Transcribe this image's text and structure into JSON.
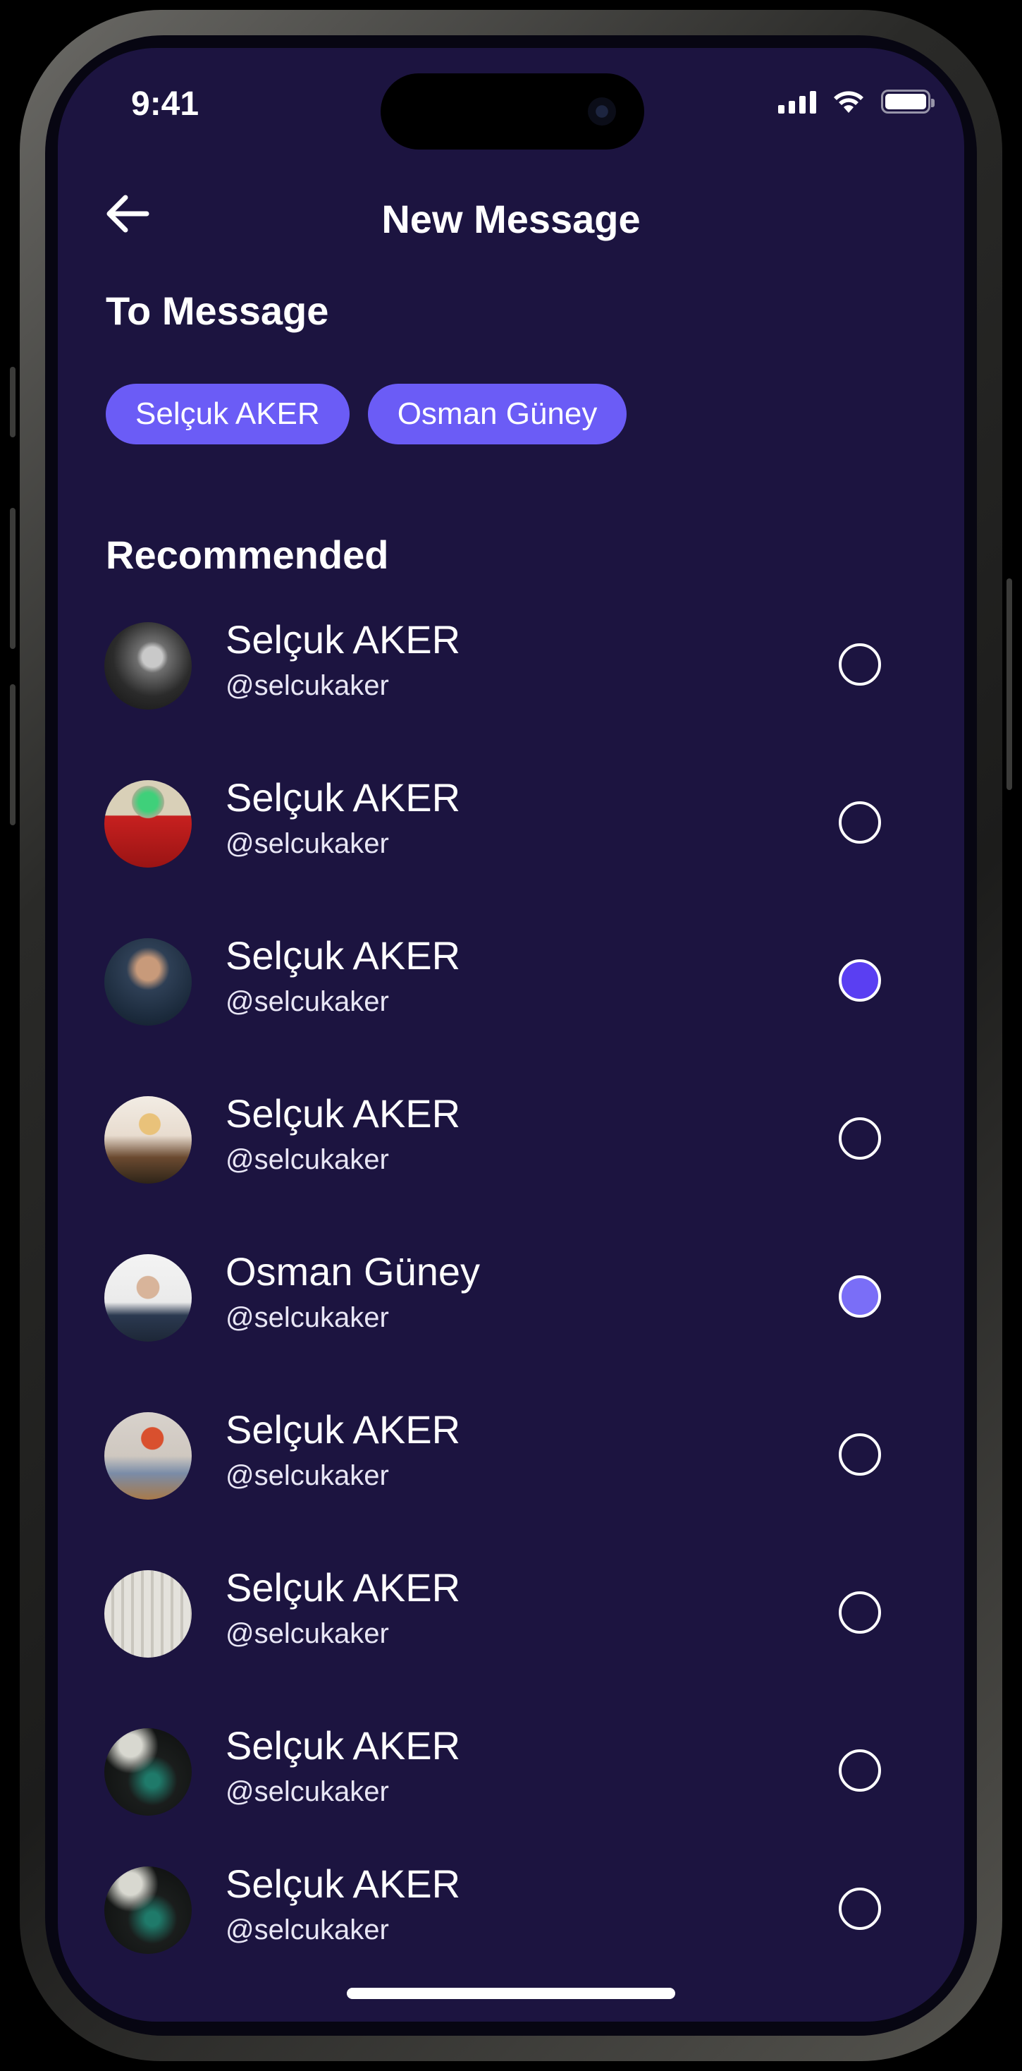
{
  "status": {
    "time": "9:41"
  },
  "header": {
    "title": "New Message"
  },
  "to_section": {
    "label": "To Message",
    "chips": [
      "Selçuk AKER",
      "Osman Güney"
    ]
  },
  "recommended": {
    "label": "Recommended",
    "contacts": [
      {
        "name": "Selçuk AKER",
        "handle": "@selcukaker",
        "selected": false
      },
      {
        "name": "Selçuk AKER",
        "handle": "@selcukaker",
        "selected": false
      },
      {
        "name": "Selçuk AKER",
        "handle": "@selcukaker",
        "selected": true
      },
      {
        "name": "Selçuk AKER",
        "handle": "@selcukaker",
        "selected": false
      },
      {
        "name": "Osman Güney",
        "handle": "@selcukaker",
        "selected": true
      },
      {
        "name": "Selçuk AKER",
        "handle": "@selcukaker",
        "selected": false
      },
      {
        "name": "Selçuk AKER",
        "handle": "@selcukaker",
        "selected": false
      },
      {
        "name": "Selçuk AKER",
        "handle": "@selcukaker",
        "selected": false
      },
      {
        "name": "Selçuk AKER",
        "handle": "@selcukaker",
        "selected": false
      }
    ]
  },
  "colors": {
    "background": "#1c1440",
    "chip": "#6b5cf6",
    "radio_selected": "#5a3ff2",
    "radio_selected_alt": "#7a6ef7"
  }
}
